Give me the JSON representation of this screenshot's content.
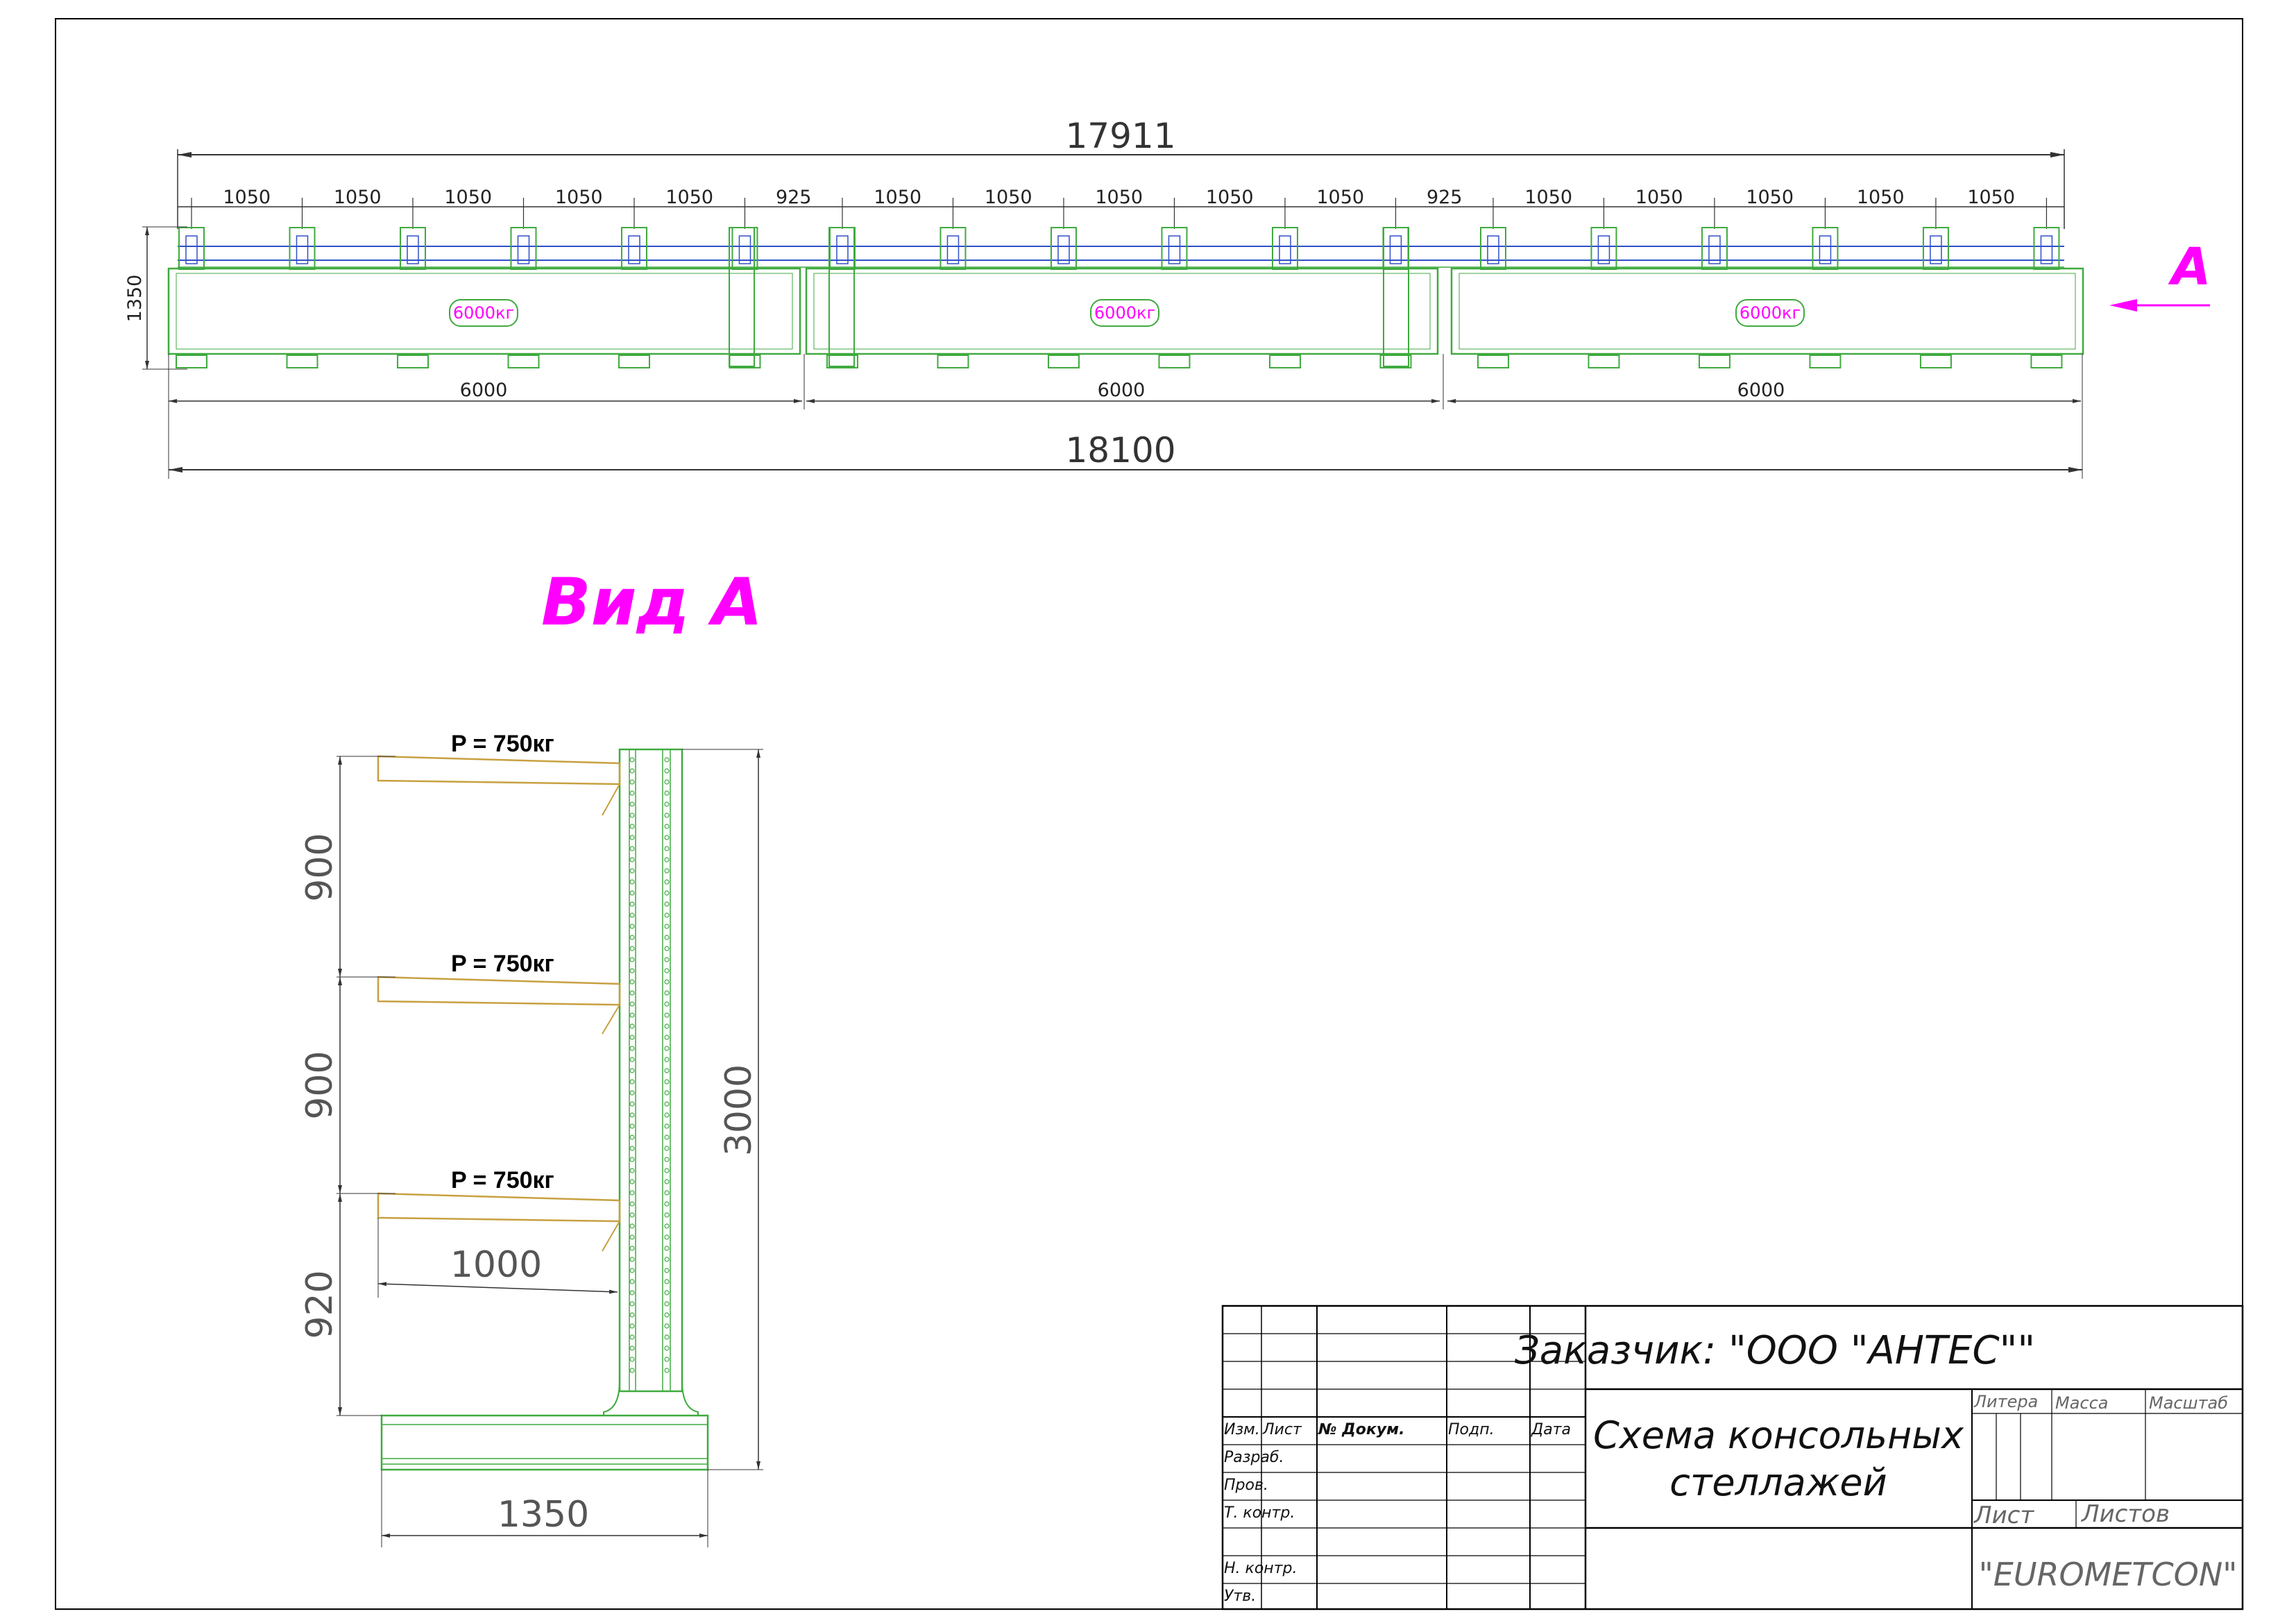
{
  "plan": {
    "overall_top": "17911",
    "overall_bottom": "18100",
    "depth": "1350",
    "section_length": "6000",
    "load_label": "6000кг",
    "spacings": [
      "1050",
      "1050",
      "1050",
      "1050",
      "1050",
      "925",
      "1050",
      "1050",
      "1050",
      "1050",
      "1050",
      "925",
      "1050",
      "1050",
      "1050",
      "1050",
      "1050"
    ],
    "view_marker": "A"
  },
  "view_a": {
    "title": "Вид А",
    "load_label": "P = 750кг",
    "level_dims": [
      "900",
      "900",
      "920"
    ],
    "height": "3000",
    "arm_length": "1000",
    "base_width": "1350"
  },
  "title_block": {
    "customer": "Заказчик: \"ООО \"АНТЕС\"\"",
    "title_line1": "Схема консольных",
    "title_line2": "стеллажей",
    "col_izm": "Изм.",
    "col_list": "Лист",
    "col_doc": "№ Докум.",
    "col_podp": "Подп.",
    "col_data": "Дата",
    "row_razrab": "Разраб.",
    "row_prov": "Пров.",
    "row_tkontr": "Т. контр.",
    "row_nkontr": "Н. контр.",
    "row_utv": "Утв.",
    "litera": "Литера",
    "massa": "Масса",
    "masshtab": "Масштаб",
    "list": "Лист",
    "listov": "Листов",
    "company": "\"EUROMETCON\""
  },
  "colors": {
    "frame": "#000000",
    "dimension": "#333333",
    "rack": "#3faa3f",
    "arm": "#c8a040",
    "beam": "#3050c8",
    "accent": "#ff00ff"
  }
}
